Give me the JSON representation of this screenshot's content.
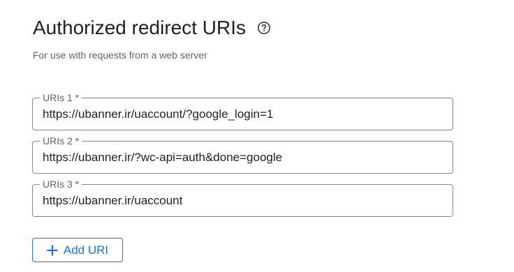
{
  "section": {
    "title": "Authorized redirect URIs",
    "help_icon": "help-circle-icon",
    "subtitle": "For use with requests from a web server"
  },
  "uris": [
    {
      "label": "URIs 1 *",
      "value": "https://ubanner.ir/uaccount/?google_login=1"
    },
    {
      "label": "URIs 2 *",
      "value": "https://ubanner.ir/?wc-api=auth&done=google"
    },
    {
      "label": "URIs 3 *",
      "value": "https://ubanner.ir/uaccount"
    }
  ],
  "add_button": {
    "label": "Add URI",
    "icon": "plus-icon"
  },
  "colors": {
    "accent": "#1a73e8",
    "text": "#202124",
    "secondary_text": "#5f6368",
    "border": "#80868b"
  }
}
